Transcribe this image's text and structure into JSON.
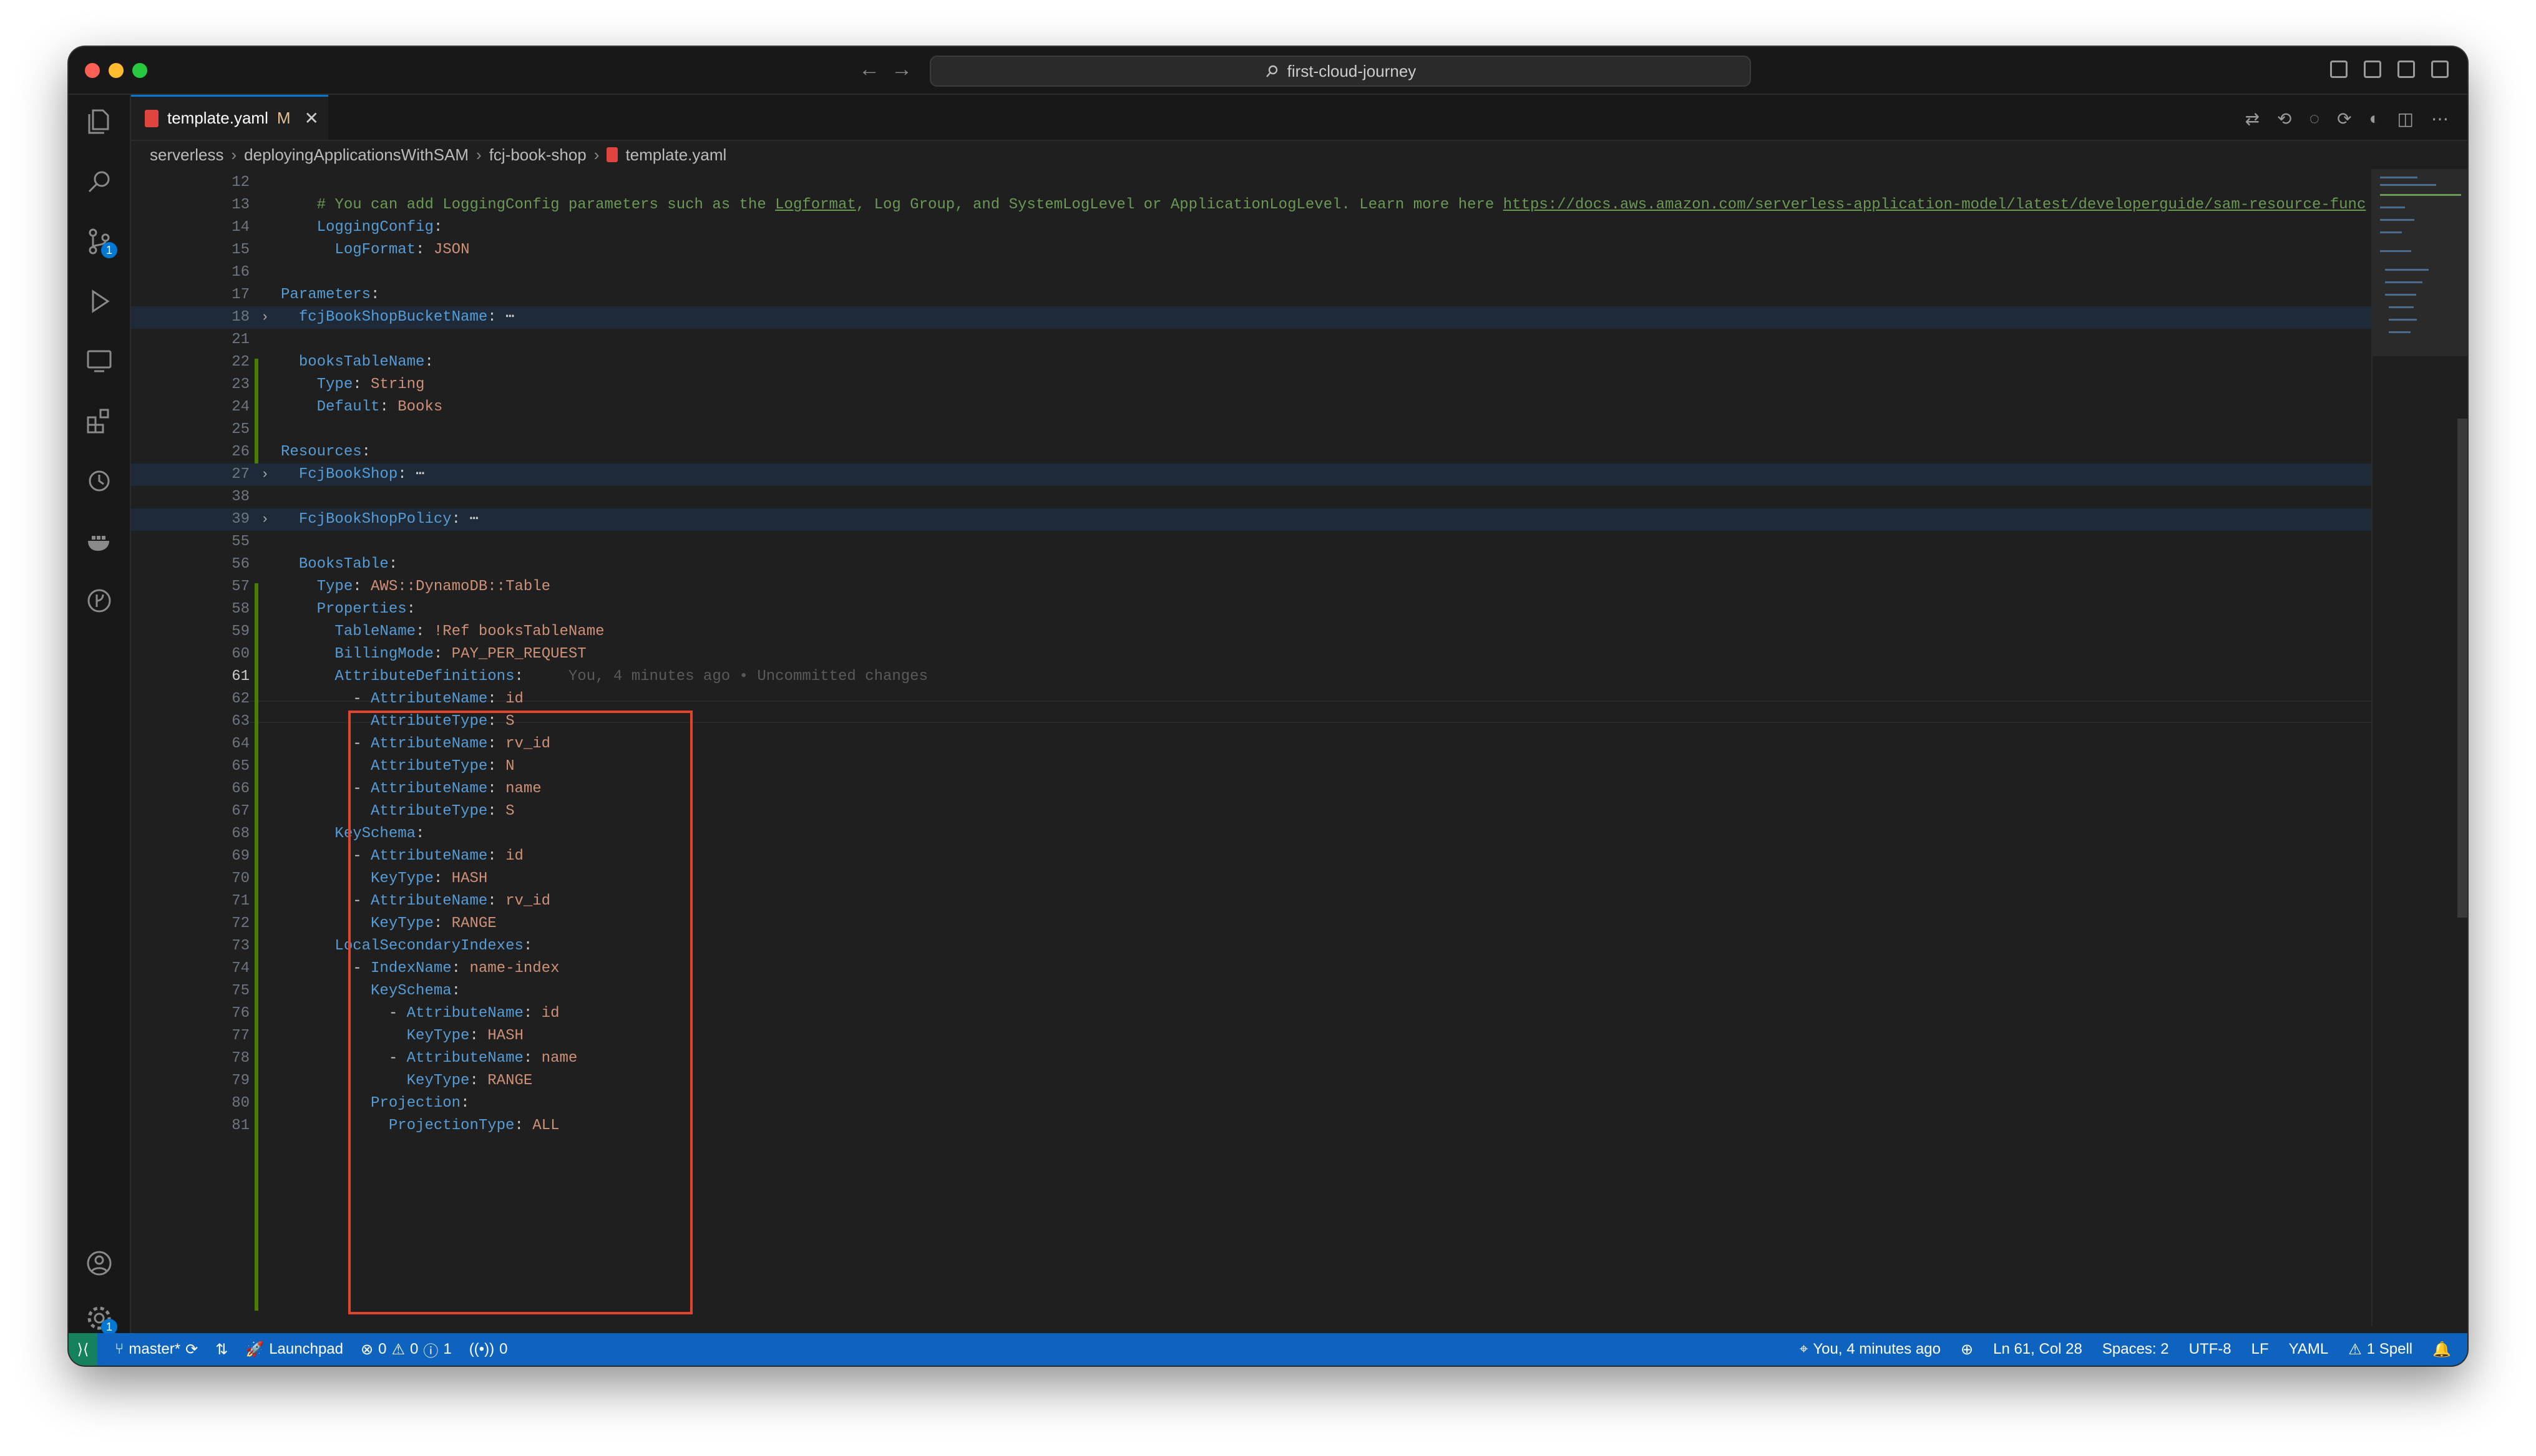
{
  "titlebar": {
    "search": "first-cloud-journey"
  },
  "tab": {
    "filename": "template.yaml",
    "modified": "M",
    "close": "✕"
  },
  "breadcrumb": [
    "serverless",
    "deployingApplicationsWithSAM",
    "fcj-book-shop",
    "template.yaml"
  ],
  "editor": {
    "current_line": "61",
    "ghost_text": "You, 4 minutes ago • Uncommitted changes",
    "lines": [
      {
        "n": "12",
        "t": ""
      },
      {
        "n": "13",
        "t": "    # You can add LoggingConfig parameters such as the Logformat, Log Group, and SystemLogLevel or ApplicationLogLevel. Learn more here https://docs.aws.amazon.com/serverless-application-model/latest/developerguide/sam-resource-func"
      },
      {
        "n": "14",
        "t": "    LoggingConfig:"
      },
      {
        "n": "15",
        "t": "      LogFormat: JSON"
      },
      {
        "n": "16",
        "t": ""
      },
      {
        "n": "17",
        "t": "Parameters:"
      },
      {
        "n": "18",
        "t": "  fcjBookShopBucketName: ⋯"
      },
      {
        "n": "21",
        "t": ""
      },
      {
        "n": "22",
        "t": "  booksTableName:"
      },
      {
        "n": "23",
        "t": "    Type: String"
      },
      {
        "n": "24",
        "t": "    Default: Books"
      },
      {
        "n": "25",
        "t": ""
      },
      {
        "n": "26",
        "t": "Resources:"
      },
      {
        "n": "27",
        "t": "  FcjBookShop: ⋯"
      },
      {
        "n": "38",
        "t": ""
      },
      {
        "n": "39",
        "t": "  FcjBookShopPolicy: ⋯"
      },
      {
        "n": "55",
        "t": ""
      },
      {
        "n": "56",
        "t": "  BooksTable:"
      },
      {
        "n": "57",
        "t": "    Type: AWS::DynamoDB::Table"
      },
      {
        "n": "58",
        "t": "    Properties:"
      },
      {
        "n": "59",
        "t": "      TableName: !Ref booksTableName"
      },
      {
        "n": "60",
        "t": "      BillingMode: PAY_PER_REQUEST"
      },
      {
        "n": "61",
        "t": "      AttributeDefinitions:"
      },
      {
        "n": "62",
        "t": "        - AttributeName: id"
      },
      {
        "n": "63",
        "t": "          AttributeType: S"
      },
      {
        "n": "64",
        "t": "        - AttributeName: rv_id"
      },
      {
        "n": "65",
        "t": "          AttributeType: N"
      },
      {
        "n": "66",
        "t": "        - AttributeName: name"
      },
      {
        "n": "67",
        "t": "          AttributeType: S"
      },
      {
        "n": "68",
        "t": "      KeySchema:"
      },
      {
        "n": "69",
        "t": "        - AttributeName: id"
      },
      {
        "n": "70",
        "t": "          KeyType: HASH"
      },
      {
        "n": "71",
        "t": "        - AttributeName: rv_id"
      },
      {
        "n": "72",
        "t": "          KeyType: RANGE"
      },
      {
        "n": "73",
        "t": "      LocalSecondaryIndexes:"
      },
      {
        "n": "74",
        "t": "        - IndexName: name-index"
      },
      {
        "n": "75",
        "t": "          KeySchema:"
      },
      {
        "n": "76",
        "t": "            - AttributeName: id"
      },
      {
        "n": "77",
        "t": "              KeyType: HASH"
      },
      {
        "n": "78",
        "t": "            - AttributeName: name"
      },
      {
        "n": "79",
        "t": "              KeyType: RANGE"
      },
      {
        "n": "80",
        "t": "          Projection:"
      },
      {
        "n": "81",
        "t": "            ProjectionType: ALL"
      }
    ]
  },
  "statusbar": {
    "branch": "master*",
    "launchpad": "Launchpad",
    "errors": "0",
    "warnings": "0",
    "info": "1",
    "ports": "0",
    "blame": "You, 4 minutes ago",
    "position": "Ln 61, Col 28",
    "spaces": "Spaces: 2",
    "encoding": "UTF-8",
    "eol": "LF",
    "language": "YAML",
    "spell": "1 Spell"
  },
  "activity_badges": {
    "source_control": "1",
    "settings": "1"
  },
  "colors": {
    "statusbar": "#0e63be",
    "highlight_box": "#e0442c",
    "key": "#569cd6",
    "string": "#ce9178",
    "comment": "#6a9955"
  }
}
